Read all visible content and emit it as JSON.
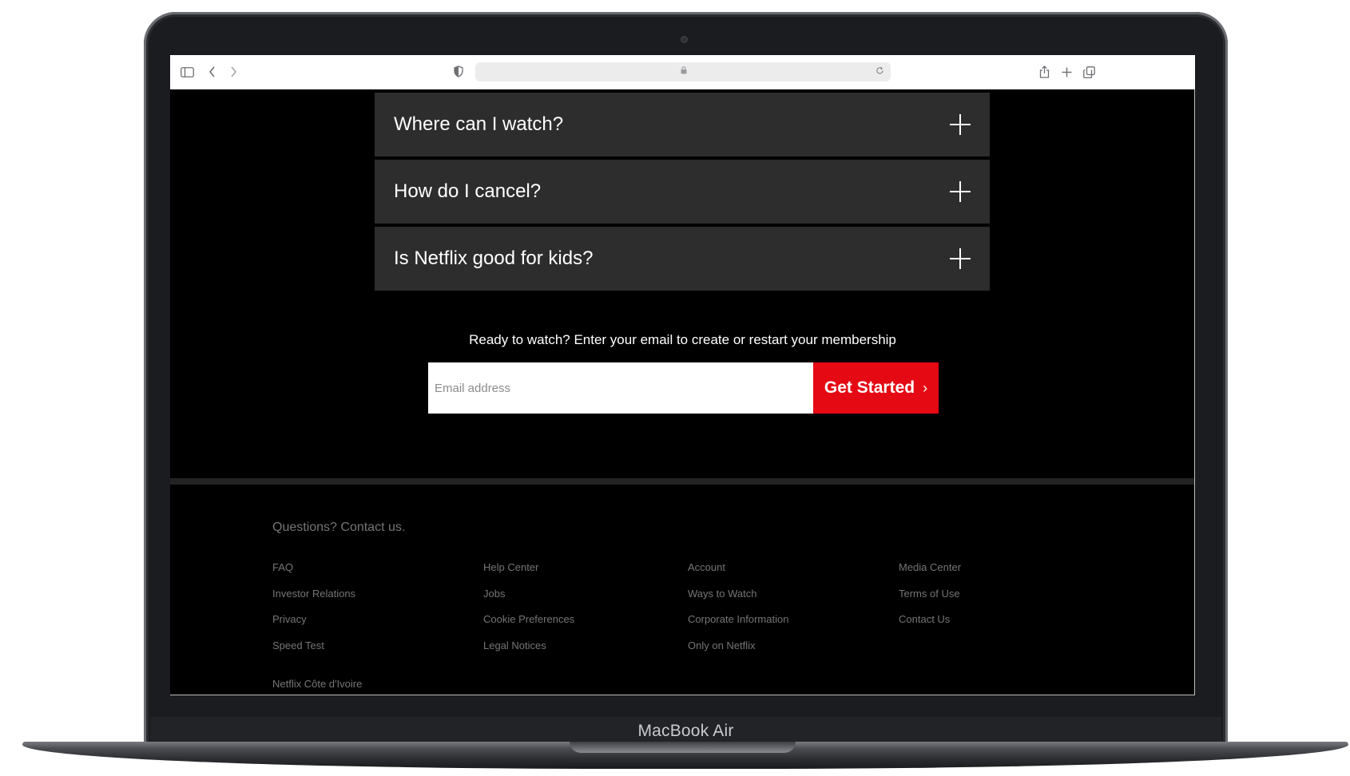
{
  "device": {
    "label": "MacBook Air"
  },
  "browser": {
    "sidebar_icon": "sidebar-icon",
    "back_icon": "chevron-left-icon",
    "forward_icon": "chevron-right-icon",
    "privacy_icon": "shield-icon",
    "lock_icon": "lock-icon",
    "reload_icon": "reload-icon",
    "share_icon": "share-icon",
    "new_tab_icon": "plus-icon",
    "tabs_icon": "tabs-overview-icon",
    "url": ""
  },
  "faq": {
    "items": [
      {
        "question": "Where can I watch?"
      },
      {
        "question": "How do I cancel?"
      },
      {
        "question": "Is Netflix good for kids?"
      }
    ]
  },
  "cta": {
    "text": "Ready to watch? Enter your email to create or restart your membership",
    "email_placeholder": "Email address",
    "email_value": "",
    "button_label": "Get Started",
    "button_chevron": "›",
    "button_color": "#e50914"
  },
  "footer": {
    "contact": "Questions? Contact us.",
    "columns": [
      [
        "FAQ",
        "Investor Relations",
        "Privacy",
        "Speed Test"
      ],
      [
        "Help Center",
        "Jobs",
        "Cookie Preferences",
        "Legal Notices"
      ],
      [
        "Account",
        "Ways to Watch",
        "Corporate Information",
        "Only on Netflix"
      ],
      [
        "Media Center",
        "Terms of Use",
        "Contact Us"
      ]
    ],
    "country": "Netflix Côte d'Ivoire"
  }
}
